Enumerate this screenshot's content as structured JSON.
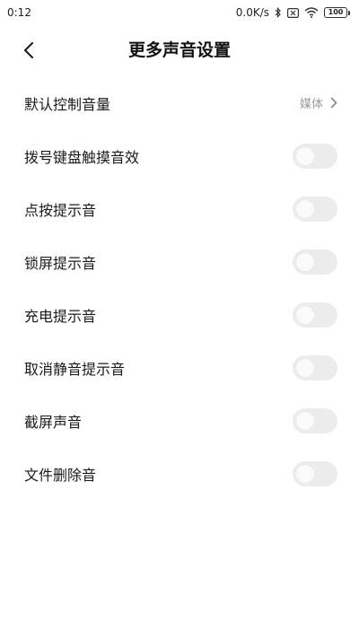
{
  "status_bar": {
    "time": "0:12",
    "network_speed": "0.0K/s",
    "battery_level": "100",
    "icons": [
      "bluetooth-icon",
      "sim-disabled-icon",
      "wifi-icon",
      "battery-icon"
    ]
  },
  "header": {
    "title": "更多声音设置",
    "back_icon": "chevron-left-icon"
  },
  "settings": {
    "default_volume": {
      "label": "默认控制音量",
      "value": "媒体",
      "icon": "chevron-right-icon"
    },
    "toggles": [
      {
        "label": "拨号键盘触摸音效",
        "enabled": false
      },
      {
        "label": "点按提示音",
        "enabled": false
      },
      {
        "label": "锁屏提示音",
        "enabled": false
      },
      {
        "label": "充电提示音",
        "enabled": false
      },
      {
        "label": "取消静音提示音",
        "enabled": false
      },
      {
        "label": "截屏声音",
        "enabled": false
      },
      {
        "label": "文件删除音",
        "enabled": false
      }
    ]
  },
  "colors": {
    "toggle_off_track": "#ececec",
    "toggle_off_knob": "#fafafa",
    "secondary_text": "#999999",
    "primary_text": "#1a1a1a"
  }
}
